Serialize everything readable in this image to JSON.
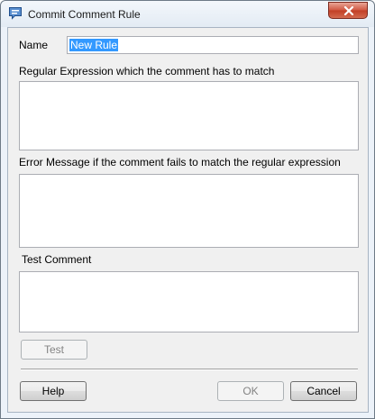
{
  "window": {
    "title": "Commit Comment Rule",
    "icon": "speech-bubble-icon",
    "close_icon": "close-icon"
  },
  "form": {
    "name_label": "Name",
    "name_value": "New Rule",
    "regex_label": "Regular Expression which the comment has to match",
    "regex_value": "",
    "error_label": "Error Message if the comment fails to match the regular expression",
    "error_value": "",
    "test_label": "Test Comment",
    "test_value": ""
  },
  "buttons": {
    "test": "Test",
    "help": "Help",
    "ok": "OK",
    "cancel": "Cancel"
  },
  "colors": {
    "selection": "#3399ff",
    "close_button": "#c13d24"
  }
}
